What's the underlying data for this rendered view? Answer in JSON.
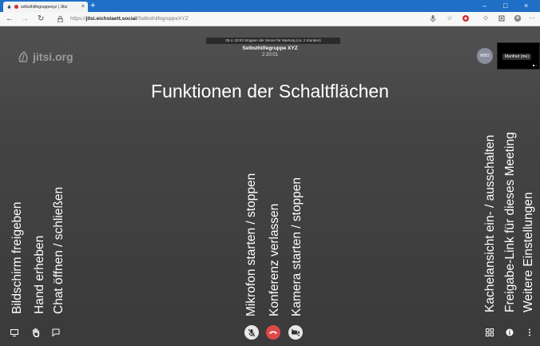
{
  "browser": {
    "tab_title": "selbsthilfegruppexyz | Jitsi",
    "tab_close": "×",
    "new_tab": "+",
    "minimize": "–",
    "maximize": "□",
    "close": "×",
    "back": "←",
    "forward": "→",
    "reload": "↻",
    "url_prefix": "https://",
    "url_domain": "jitsi.eichstaett.social",
    "url_path": "/SelbsthilfegruppeXYZ",
    "more_menu": "···"
  },
  "meeting": {
    "logo_text": "jitsi.org",
    "notice": "29.4. 23:00 Stoppen der Server für Wartung (ca. 2 Stunden)",
    "title": "Selbsthilfegruppe XYZ",
    "timer": "2:20:01",
    "avatar_initials": "MBO",
    "self_name": "Manfred (me)",
    "heading": "Funktionen der Schaltflächen"
  },
  "labels": {
    "screen_share": "Bildschirm freigeben",
    "raise_hand": "Hand erheben",
    "chat": "Chat öffnen / schließen",
    "mic": "Mikrofon starten / stoppen",
    "leave": "Konferenz verlassen",
    "camera": "Kamera starten / stoppen",
    "tile_view": "Kachelansicht ein- / ausschalten",
    "invite": "Freigabe-Link für dieses Meeting",
    "more": "Weitere Einstellungen"
  },
  "colors": {
    "tabbar": "#1f6fc7",
    "hangup": "#e04848",
    "stage": "#474747"
  }
}
